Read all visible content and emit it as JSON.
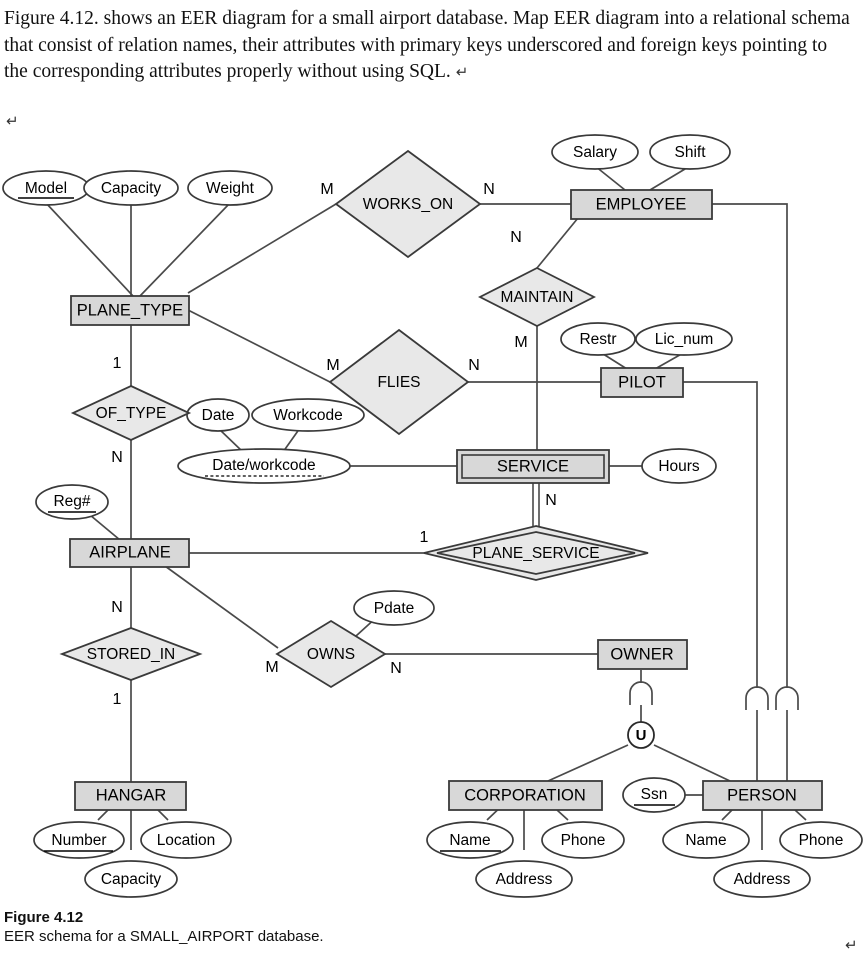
{
  "question": {
    "text": "Figure 4.12. shows an EER diagram for a small airport database. Map EER diagram into a relational schema that consist of relation names, their attributes with primary keys underscored and foreign keys pointing to the corresponding attributes properly without using SQL.",
    "pilcrow": "↵",
    "blank_line_pilcrow": "↵"
  },
  "caption": {
    "title": "Figure 4.12",
    "text": "EER schema for a SMALL_AIRPORT database.",
    "pilcrow": "↵"
  },
  "colors": {
    "entity_fill": "#d8d8d8",
    "relationship_fill": "#e8e8e8",
    "attribute_fill": "#ffffff",
    "line": "#4a4a4a",
    "border": "#3a3a3a",
    "background": "#ffffff"
  },
  "chart_data": {
    "type": "diagram",
    "title": "EER schema for a SMALL_AIRPORT database.",
    "notation": "Chen / EER",
    "entities": [
      {
        "name": "PLANE_TYPE",
        "kind": "strong",
        "attributes": [
          {
            "name": "Model",
            "key": "primary"
          },
          {
            "name": "Capacity",
            "key": "none"
          },
          {
            "name": "Weight",
            "key": "none"
          }
        ]
      },
      {
        "name": "EMPLOYEE",
        "kind": "strong",
        "attributes": [
          {
            "name": "Salary",
            "key": "none"
          },
          {
            "name": "Shift",
            "key": "none"
          }
        ]
      },
      {
        "name": "PILOT",
        "kind": "strong",
        "attributes": [
          {
            "name": "Restr",
            "key": "none"
          },
          {
            "name": "Lic_num",
            "key": "none"
          }
        ]
      },
      {
        "name": "SERVICE",
        "kind": "weak",
        "attributes": [
          {
            "name": "Date/workcode",
            "key": "partial",
            "components": [
              "Date",
              "Workcode"
            ]
          },
          {
            "name": "Hours",
            "key": "none"
          }
        ]
      },
      {
        "name": "AIRPLANE",
        "kind": "strong",
        "attributes": [
          {
            "name": "Reg#",
            "key": "primary"
          }
        ]
      },
      {
        "name": "HANGAR",
        "kind": "strong",
        "attributes": [
          {
            "name": "Number",
            "key": "primary"
          },
          {
            "name": "Location",
            "key": "none"
          },
          {
            "name": "Capacity",
            "key": "none"
          }
        ]
      },
      {
        "name": "OWNER",
        "kind": "strong",
        "attributes": []
      },
      {
        "name": "CORPORATION",
        "kind": "strong",
        "attributes": [
          {
            "name": "Name",
            "key": "primary"
          },
          {
            "name": "Phone",
            "key": "none"
          },
          {
            "name": "Address",
            "key": "none"
          }
        ]
      },
      {
        "name": "PERSON",
        "kind": "strong",
        "attributes": [
          {
            "name": "Ssn",
            "key": "primary"
          },
          {
            "name": "Name",
            "key": "none"
          },
          {
            "name": "Phone",
            "key": "none"
          },
          {
            "name": "Address",
            "key": "none"
          }
        ]
      }
    ],
    "relationships": [
      {
        "name": "WORKS_ON",
        "kind": "regular",
        "participants": [
          {
            "entity": "PLANE_TYPE",
            "cardinality": "M"
          },
          {
            "entity": "EMPLOYEE",
            "cardinality": "N"
          }
        ]
      },
      {
        "name": "MAINTAIN",
        "kind": "regular",
        "participants": [
          {
            "entity": "EMPLOYEE",
            "cardinality": "N"
          },
          {
            "entity": "SERVICE",
            "cardinality": "M"
          }
        ]
      },
      {
        "name": "FLIES",
        "kind": "regular",
        "participants": [
          {
            "entity": "PLANE_TYPE",
            "cardinality": "M"
          },
          {
            "entity": "PILOT",
            "cardinality": "N"
          }
        ]
      },
      {
        "name": "OF_TYPE",
        "kind": "regular",
        "participants": [
          {
            "entity": "PLANE_TYPE",
            "cardinality": "1"
          },
          {
            "entity": "AIRPLANE",
            "cardinality": "N"
          }
        ]
      },
      {
        "name": "PLANE_SERVICE",
        "kind": "identifying",
        "participants": [
          {
            "entity": "SERVICE",
            "cardinality": "N"
          },
          {
            "entity": "AIRPLANE",
            "cardinality": "1"
          }
        ]
      },
      {
        "name": "STORED_IN",
        "kind": "regular",
        "participants": [
          {
            "entity": "AIRPLANE",
            "cardinality": "N"
          },
          {
            "entity": "HANGAR",
            "cardinality": "1"
          }
        ]
      },
      {
        "name": "OWNS",
        "kind": "regular",
        "attributes": [
          {
            "name": "Pdate",
            "key": "none"
          }
        ],
        "participants": [
          {
            "entity": "AIRPLANE",
            "cardinality": "M"
          },
          {
            "entity": "OWNER",
            "cardinality": "N"
          }
        ]
      }
    ],
    "specialization": {
      "symbol": "U",
      "superclass": "OWNER",
      "subclasses": [
        "CORPORATION",
        "PERSON"
      ],
      "disjointness": "union/category"
    },
    "is_a_links": [
      {
        "from": "EMPLOYEE",
        "to": "PERSON"
      },
      {
        "from": "PILOT",
        "to": "PERSON"
      }
    ]
  },
  "nodes": {
    "entities": {
      "plane_type": "PLANE_TYPE",
      "employee": "EMPLOYEE",
      "pilot": "PILOT",
      "service": "SERVICE",
      "airplane": "AIRPLANE",
      "hangar": "HANGAR",
      "owner": "OWNER",
      "corporation": "CORPORATION",
      "person": "PERSON"
    },
    "relationships": {
      "works_on": "WORKS_ON",
      "maintain": "MAINTAIN",
      "flies": "FLIES",
      "of_type": "OF_TYPE",
      "plane_service": "PLANE_SERVICE",
      "stored_in": "STORED_IN",
      "owns": "OWNS"
    },
    "attributes": {
      "model": "Model",
      "capacity_pt": "Capacity",
      "weight": "Weight",
      "salary": "Salary",
      "shift": "Shift",
      "restr": "Restr",
      "lic_num": "Lic_num",
      "date": "Date",
      "workcode": "Workcode",
      "date_workcode": "Date/workcode",
      "hours": "Hours",
      "reg_num": "Reg#",
      "pdate": "Pdate",
      "number": "Number",
      "location": "Location",
      "capacity_h": "Capacity",
      "ssn": "Ssn",
      "corp_name": "Name",
      "corp_phone": "Phone",
      "corp_address": "Address",
      "person_name": "Name",
      "person_phone": "Phone",
      "person_address": "Address"
    },
    "cardinalities": {
      "works_on_m": "M",
      "works_on_n": "N",
      "maintain_n": "N",
      "maintain_m": "M",
      "flies_m": "M",
      "flies_n": "N",
      "of_type_1": "1",
      "of_type_n": "N",
      "plane_service_n": "N",
      "plane_service_1": "1",
      "stored_in_n": "N",
      "stored_in_1": "1",
      "owns_m": "M",
      "owns_n": "N"
    },
    "specialization_symbol": "U"
  }
}
